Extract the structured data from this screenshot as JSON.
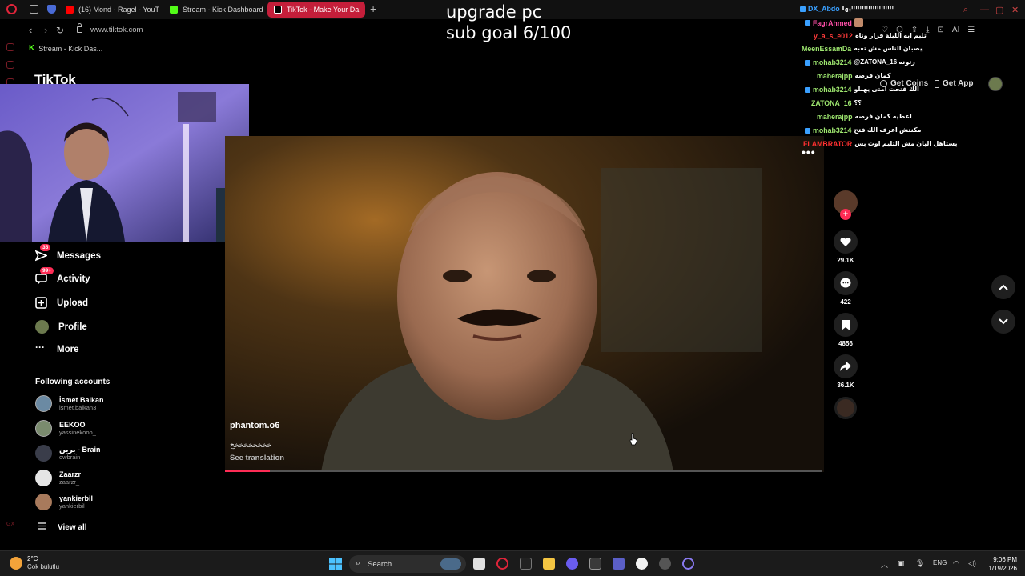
{
  "browser": {
    "tabs": [
      {
        "label": "(16) Mond - Ragel - YouTu",
        "favicon_color": "#ff0000"
      },
      {
        "label": "Stream - Kick Dashboard",
        "favicon_color": "#53fc18"
      },
      {
        "label": "TikTok - Make Your Da",
        "favicon_color": "#000000",
        "active": true
      }
    ],
    "url": "www.tiktok.com",
    "bookmark": "Stream - Kick Das..."
  },
  "overlay": {
    "line1": "upgrade pc",
    "line2": "sub goal 6/100"
  },
  "tiktok": {
    "logo": "TikTok",
    "nav": [
      {
        "label": "Messages",
        "badge": "35",
        "icon": "paper-plane-icon"
      },
      {
        "label": "Activity",
        "badge": "99+",
        "icon": "message-icon"
      },
      {
        "label": "Upload",
        "badge": "",
        "icon": "plus-square-icon"
      },
      {
        "label": "Profile",
        "badge": "",
        "icon": "avatar-icon"
      },
      {
        "label": "More",
        "badge": "",
        "icon": "ellipsis-icon"
      }
    ],
    "following_title": "Following accounts",
    "following": [
      {
        "name": "İsmet Balkan",
        "handle": "ismet.balkan3",
        "color": "#6b8aa3"
      },
      {
        "name": "EEKOO",
        "handle": "yassinekooo_",
        "color": "#7a8b6e"
      },
      {
        "name": "برين - Brain",
        "handle": "owbrain",
        "color": "#3a3d4a"
      },
      {
        "name": "Zaarzr",
        "handle": "zaarzr_",
        "color": "#e5e5e5"
      },
      {
        "name": "yankierbil",
        "handle": "yankierbil",
        "color": "#a87a5c"
      }
    ],
    "view_all": "View all",
    "video": {
      "author": "phantom.o6",
      "caption": "خخخخخخخخخ",
      "see_translation": "See translation",
      "progress": 0.075
    },
    "actions": {
      "likes": "29.1K",
      "comments": "422",
      "saves": "4856",
      "shares": "36.1K"
    },
    "get_coins": "Get Coins",
    "get_app": "Get App"
  },
  "chat": [
    {
      "user": "DX_Abdo",
      "color": "#3aa0ff",
      "msg": "يها!!!!!!!!!!!!!!!!!!!!"
    },
    {
      "user": "FagrAhmed",
      "color": "#ff4fa8",
      "msg": ""
    },
    {
      "user": "y_a_s_e012",
      "color": "#ff3a3a",
      "msg": "تليم ايه الليلة فرار وناة"
    },
    {
      "user": "MeenEssamDa",
      "color": "#9fe870",
      "msg": "يصبان الناس مش تعبه"
    },
    {
      "user": "mohab3214",
      "color": "#9fe870",
      "msg": "@ZATONA_16 زتونه"
    },
    {
      "user": "maherajpp",
      "color": "#9fe870",
      "msg": "كمان فرصه"
    },
    {
      "user": "mohab3214",
      "color": "#9fe870",
      "msg": "الك فتحت امتى يهبلو"
    },
    {
      "user": "ZATONA_16",
      "color": "#9fe870",
      "msg": "؟؟"
    },
    {
      "user": "maherajpp",
      "color": "#9fe870",
      "msg": "اعطيه كمان فرصه"
    },
    {
      "user": "mohab3214",
      "color": "#9fe870",
      "msg": "مكنتش اعرف الك فتح"
    },
    {
      "user": "FLAMBRATOR",
      "color": "#ff3030",
      "msg": "بستاهل البان مش التليم اوت بس"
    }
  ],
  "taskbar": {
    "temp": "2°C",
    "weather": "Çok bulutlu",
    "search": "Search",
    "lang": "ENG",
    "time": "9:06 PM",
    "date": "1/19/2026"
  }
}
